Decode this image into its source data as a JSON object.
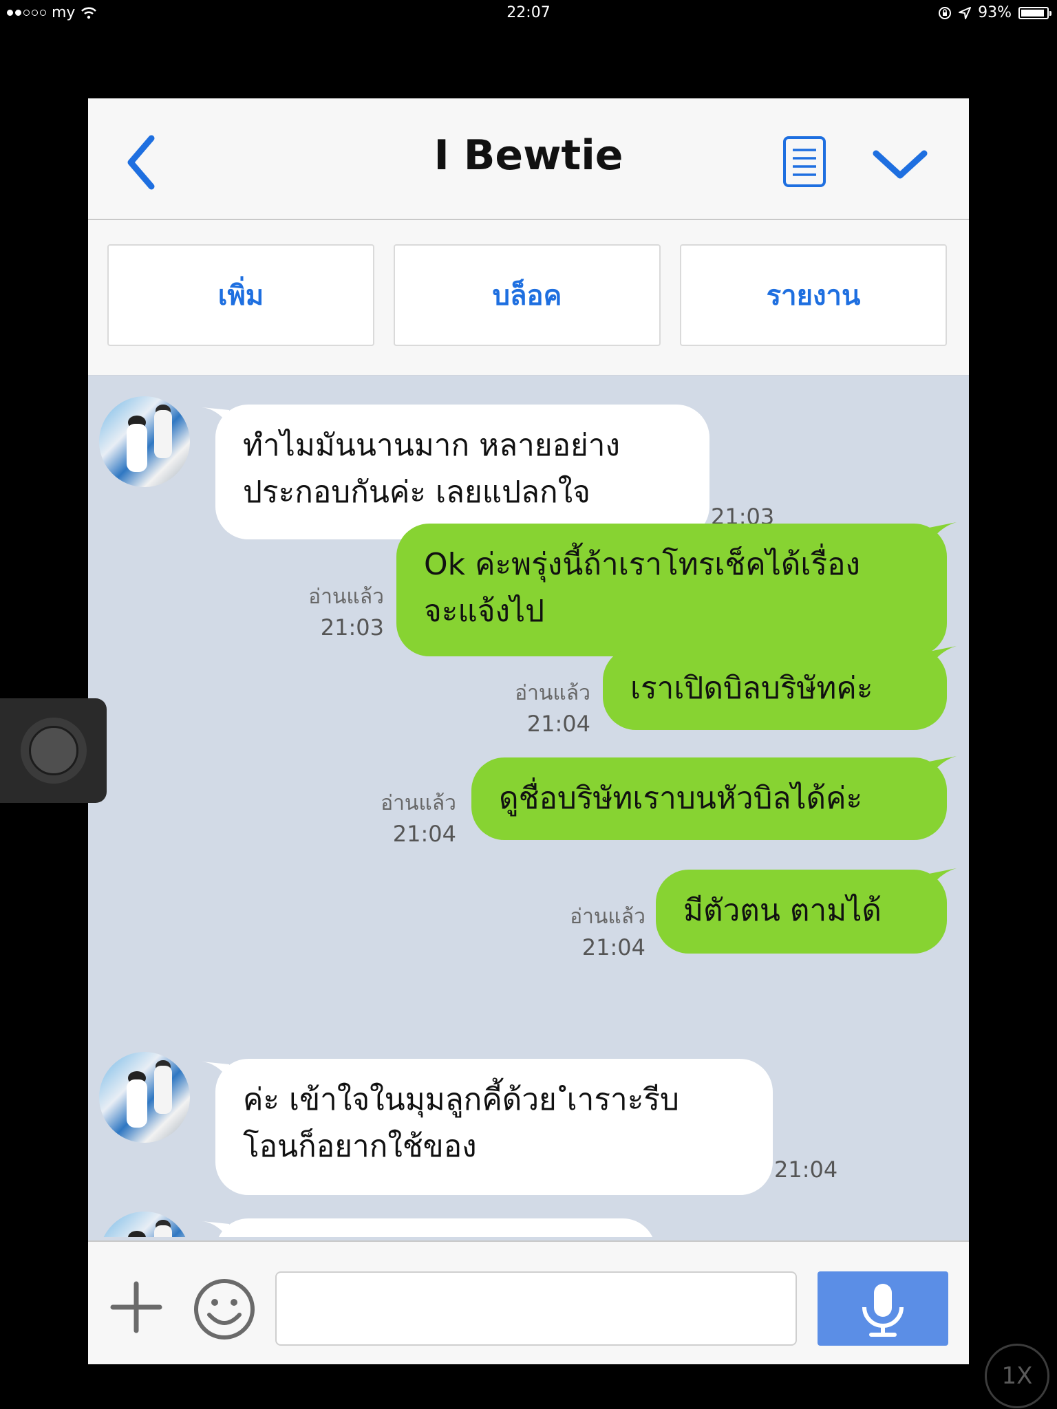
{
  "status_bar": {
    "carrier": "my",
    "time": "22:07",
    "battery_percent": "93%",
    "battery_level": 0.93
  },
  "header": {
    "title": "I Bewtie"
  },
  "actions": [
    {
      "label": "เพิ่ม"
    },
    {
      "label": "บล็อค"
    },
    {
      "label": "รายงาน"
    }
  ],
  "messages": [
    {
      "direction": "in",
      "text": "ทำไมมันนานมาก หลายอย่าง\nประกอบกันค่ะ เลยแปลกใจ",
      "time": "21:03"
    },
    {
      "direction": "out",
      "text": "Ok ค่ะพรุ่งนี้ถ้าเราโทรเช็คได้เรื่อง\nจะแจ้งไป",
      "read": "อ่านแล้ว",
      "time": "21:03"
    },
    {
      "direction": "out",
      "text": "เราเปิดบิลบริษัทค่ะ",
      "read": "อ่านแล้ว",
      "time": "21:04"
    },
    {
      "direction": "out",
      "text": "ดูชื่อบริษัทเราบนหัวบิลได้ค่ะ",
      "read": "อ่านแล้ว",
      "time": "21:04"
    },
    {
      "direction": "out",
      "text": "มีตัวตน ตามได้",
      "read": "อ่านแล้ว",
      "time": "21:04"
    },
    {
      "direction": "in",
      "text": "ค่ะ เข้าใจในมุมลูกคี้ด้วย ํเาราะรีบ\nโอนก็อยากใช้ของ",
      "time": "21:04"
    }
  ],
  "input": {
    "placeholder": ""
  },
  "overlay": {
    "zoom_label": "1X"
  },
  "colors": {
    "accent_blue": "#1e6fe0",
    "outgoing_bubble": "#87d332",
    "chat_background": "#d2dae6",
    "mic_button": "#5b8ee6"
  },
  "icons": [
    "back-chevron-icon",
    "notes-icon",
    "chevron-down-icon",
    "plus-icon",
    "smiley-icon",
    "microphone-icon",
    "wifi-icon",
    "location-arrow-icon",
    "rotation-lock-icon",
    "battery-icon"
  ]
}
